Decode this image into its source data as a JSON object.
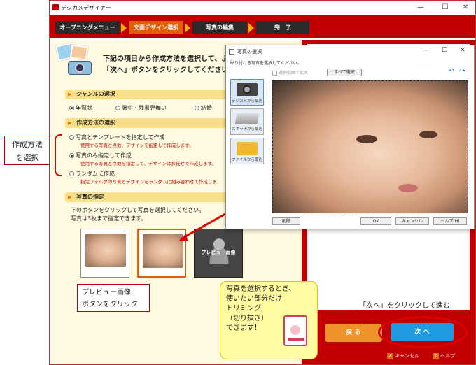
{
  "window": {
    "title": "デジカメデザイナー",
    "minimize": "—",
    "maximize": "☐",
    "close": "✕"
  },
  "steps": [
    "オープニングメニュー",
    "文面デザイン選択",
    "写真の編集",
    "完　了"
  ],
  "intro": {
    "line1": "下記の項目から作成方法を選択して、よ",
    "line2": "「次へ」ボタンをクリックしてください"
  },
  "genre": {
    "header": "ジャンルの選択",
    "options": [
      "年賀状",
      "暑中・残暑見舞い",
      "結婚"
    ]
  },
  "method": {
    "header": "作成方法の選択",
    "options": [
      {
        "label": "写真とテンプレートを指定して作成",
        "desc": "使用する写真と点数、デザインを指定して作成します。"
      },
      {
        "label": "写真のみ指定して作成",
        "desc": "使用する写真と点数を指定して、デザインはお任せで作成します。"
      },
      {
        "label": "ランダムに作成",
        "desc": "指定フォルダの写真とデザインをランダムに組み合わせて作成しま"
      }
    ]
  },
  "photo": {
    "header": "写真の指定",
    "line1": "下のボタンをクリックして写真を選択してください。",
    "line2": "写真は3枚まで指定できます。",
    "preview": "プレビュー画像"
  },
  "dialog": {
    "title": "写真の選択",
    "instruction": "貼り付ける写真を選択してください。",
    "zoom": "選択範囲で拡大",
    "select_all": "すべて選択",
    "sources": [
      "デジカメから取込",
      "スキャナから取込",
      "ファイルから取込"
    ],
    "buttons": {
      "delete": "削除",
      "ok": "OK",
      "cancel": "キャンセル",
      "help": "ヘルプ(H)"
    },
    "minimize": "—",
    "maximize": "☐",
    "close": "✕"
  },
  "nav": {
    "back": "戻 る",
    "next": "次 へ",
    "cancel": "キャンセル",
    "help": "ヘルプ"
  },
  "annotations": {
    "method_label1": "作成方法",
    "method_label2": "を選択",
    "preview_label1": "プレビュー画像",
    "preview_label2": "ボタンをクリック",
    "next_hint": "「次へ」をクリックして進む",
    "trim1": "写真を選択するとき、",
    "trim2": "使いたい部分だけ",
    "trim3": "トリミング",
    "trim4": "（切り抜き）",
    "trim5": "できます！"
  },
  "colors": {
    "accent": "#c00000",
    "highlight": "#e65c00"
  }
}
